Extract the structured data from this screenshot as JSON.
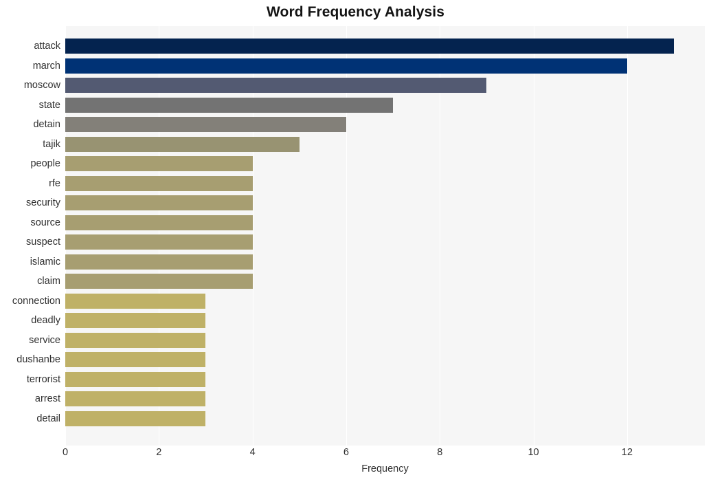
{
  "chart_data": {
    "type": "bar",
    "orientation": "horizontal",
    "title": "Word Frequency Analysis",
    "xlabel": "Frequency",
    "ylabel": "",
    "categories": [
      "attack",
      "march",
      "moscow",
      "state",
      "detain",
      "tajik",
      "people",
      "rfe",
      "security",
      "source",
      "suspect",
      "islamic",
      "claim",
      "connection",
      "deadly",
      "service",
      "dushanbe",
      "terrorist",
      "arrest",
      "detail"
    ],
    "values": [
      13,
      12,
      9,
      7,
      6,
      5,
      4,
      4,
      4,
      4,
      4,
      4,
      4,
      3,
      3,
      3,
      3,
      3,
      3,
      3
    ],
    "bar_colors": [
      "#04234f",
      "#003275",
      "#535a72",
      "#737373",
      "#838079",
      "#989372",
      "#a79e71",
      "#a79e71",
      "#a79e71",
      "#a79e71",
      "#a79e71",
      "#a79e71",
      "#a79e71",
      "#bfb167",
      "#bfb167",
      "#bfb167",
      "#bfb167",
      "#bfb167",
      "#bfb167",
      "#bfb167"
    ],
    "xlim": [
      0,
      13.66
    ],
    "xticks": [
      0,
      2,
      4,
      6,
      8,
      10,
      12
    ],
    "xtick_labels": [
      "0",
      "2",
      "4",
      "6",
      "8",
      "10",
      "12"
    ],
    "grid": true,
    "grid_axis": "x",
    "legend": false,
    "plot_background": "#f6f6f6",
    "figure_background": "#ffffff",
    "gridline_color": "#ffffff",
    "text_color": "#303030",
    "title_color": "#141414"
  }
}
